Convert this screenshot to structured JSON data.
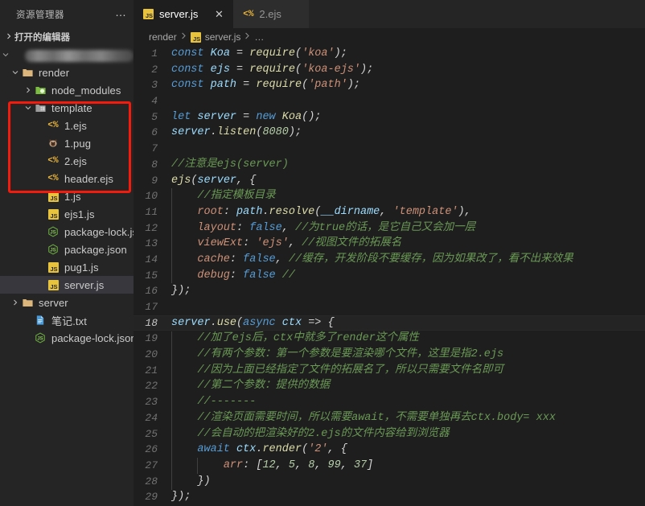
{
  "sidebar": {
    "title": "资源管理器",
    "more_label": "…",
    "open_editors_label": "打开的编辑器",
    "root_redacted": "",
    "tree": [
      {
        "name": "render",
        "icon": "folder-icon",
        "twisty": "down",
        "indent": 1,
        "selected": false
      },
      {
        "name": "node_modules",
        "icon": "folder-node-modules-icon",
        "twisty": "right",
        "indent": 2,
        "selected": false
      },
      {
        "name": "template",
        "icon": "folder-open-icon",
        "twisty": "down",
        "indent": 2,
        "selected": false
      },
      {
        "name": "1.ejs",
        "icon": "ejs-file-icon",
        "twisty": "none",
        "indent": 3,
        "selected": false
      },
      {
        "name": "1.pug",
        "icon": "pug-file-icon",
        "twisty": "none",
        "indent": 3,
        "selected": false
      },
      {
        "name": "2.ejs",
        "icon": "ejs-file-icon",
        "twisty": "none",
        "indent": 3,
        "selected": false
      },
      {
        "name": "header.ejs",
        "icon": "ejs-file-icon",
        "twisty": "none",
        "indent": 3,
        "selected": false
      },
      {
        "name": "1.js",
        "icon": "js-file-icon",
        "twisty": "none",
        "indent": 3,
        "selected": false
      },
      {
        "name": "ejs1.js",
        "icon": "js-file-icon",
        "twisty": "none",
        "indent": 3,
        "selected": false
      },
      {
        "name": "package-lock.json",
        "icon": "nodejs-file-icon",
        "twisty": "none",
        "indent": 3,
        "selected": false
      },
      {
        "name": "package.json",
        "icon": "nodejs-file-icon",
        "twisty": "none",
        "indent": 3,
        "selected": false
      },
      {
        "name": "pug1.js",
        "icon": "js-file-icon",
        "twisty": "none",
        "indent": 3,
        "selected": false
      },
      {
        "name": "server.js",
        "icon": "js-file-icon",
        "twisty": "none",
        "indent": 3,
        "selected": true
      },
      {
        "name": "server",
        "icon": "folder-icon",
        "twisty": "right",
        "indent": 1,
        "selected": false
      },
      {
        "name": "笔记.txt",
        "icon": "text-file-icon",
        "twisty": "none",
        "indent": 2,
        "selected": false
      },
      {
        "name": "package-lock.json",
        "icon": "nodejs-file-icon",
        "twisty": "none",
        "indent": 2,
        "selected": false
      }
    ],
    "highlight_box_color": "#f41b0c"
  },
  "tabs": [
    {
      "label": "server.js",
      "icon": "js-file-icon",
      "active": true,
      "close_glyph": "✕"
    },
    {
      "label": "2.ejs",
      "icon": "ejs-file-icon",
      "active": false,
      "close_glyph": ""
    }
  ],
  "breadcrumb": {
    "items": [
      "render",
      "server.js",
      "…"
    ],
    "separator": "❯"
  },
  "code": {
    "active_line": 18,
    "lines": [
      {
        "n": 1,
        "text": "const Koa = require('koa');"
      },
      {
        "n": 2,
        "text": "const ejs = require('koa-ejs');"
      },
      {
        "n": 3,
        "text": "const path = require('path');"
      },
      {
        "n": 4,
        "text": ""
      },
      {
        "n": 5,
        "text": "let server = new Koa();"
      },
      {
        "n": 6,
        "text": "server.listen(8080);"
      },
      {
        "n": 7,
        "text": ""
      },
      {
        "n": 8,
        "text": "//注意是ejs(server)"
      },
      {
        "n": 9,
        "text": "ejs(server, {"
      },
      {
        "n": 10,
        "text": "    //指定模板目录"
      },
      {
        "n": 11,
        "text": "    root: path.resolve(__dirname, 'template'),"
      },
      {
        "n": 12,
        "text": "    layout: false, //为true的话，是它自己又会加一层"
      },
      {
        "n": 13,
        "text": "    viewExt: 'ejs', //视图文件的拓展名"
      },
      {
        "n": 14,
        "text": "    cache: false, //缓存，开发阶段不要缓存，因为如果改了，看不出来效果"
      },
      {
        "n": 15,
        "text": "    debug: false //"
      },
      {
        "n": 16,
        "text": "});"
      },
      {
        "n": 17,
        "text": ""
      },
      {
        "n": 18,
        "text": "server.use(async ctx => {"
      },
      {
        "n": 19,
        "text": "    //加了ejs后，ctx中就多了render这个属性"
      },
      {
        "n": 20,
        "text": "    //有两个参数：第一个参数是要渲染哪个文件，这里是指2.ejs"
      },
      {
        "n": 21,
        "text": "    //因为上面已经指定了文件的拓展名了，所以只需要文件名即可"
      },
      {
        "n": 22,
        "text": "    //第二个参数：提供的数据"
      },
      {
        "n": 23,
        "text": "    //-------"
      },
      {
        "n": 24,
        "text": "    //渲染页面需要时间，所以需要await，不需要单独再去ctx.body= xxx"
      },
      {
        "n": 25,
        "text": "    //会自动的把渲染好的2.ejs的文件内容给到浏览器"
      },
      {
        "n": 26,
        "text": "    await ctx.render('2', {"
      },
      {
        "n": 27,
        "text": "        arr: [12, 5, 8, 99, 37]"
      },
      {
        "n": 28,
        "text": "    })"
      },
      {
        "n": 29,
        "text": "});"
      }
    ]
  },
  "theme": {
    "editor_bg": "#1e1e1e",
    "sidebar_bg": "#252526",
    "keyword": "#569cd6",
    "string": "#ce9178",
    "comment": "#6a9955",
    "number": "#b5cea8",
    "variable": "#9cdcfe",
    "function": "#dcdcaa",
    "selection": "#37373d"
  }
}
